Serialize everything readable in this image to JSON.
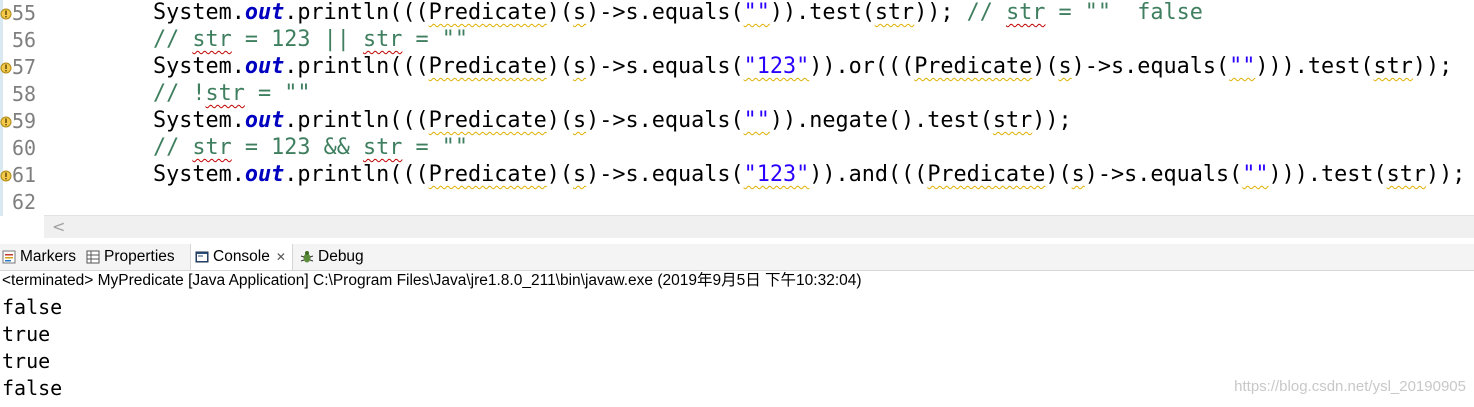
{
  "editor": {
    "lines": [
      {
        "num": "55",
        "warn": true,
        "type": "code"
      },
      {
        "num": "56",
        "warn": false,
        "type": "comment"
      },
      {
        "num": "57",
        "warn": true,
        "type": "code"
      },
      {
        "num": "58",
        "warn": false,
        "type": "comment"
      },
      {
        "num": "59",
        "warn": true,
        "type": "code"
      },
      {
        "num": "60",
        "warn": false,
        "type": "comment"
      },
      {
        "num": "61",
        "warn": true,
        "type": "code"
      },
      {
        "num": "62",
        "warn": false,
        "type": "empty"
      }
    ],
    "code": {
      "l55": {
        "a": "System.",
        "out": "out",
        "b": ".println(((",
        "pred": "Predicate",
        "c": ")(",
        "s1": "s",
        "d": ")->s.equals(",
        "str1": "\"\"",
        "e": ")).test(",
        "arg": "str",
        "f": "));",
        "cm1": " // ",
        "cmstr": "str",
        "cm2": " = \"\"  false"
      },
      "l56": {
        "cm1": "// ",
        "cmstr1": "str",
        "cm2": " = 123 || ",
        "cmstr2": "str",
        "cm3": " = \"\""
      },
      "l57": {
        "a": "System.",
        "out": "out",
        "b": ".println(((",
        "pred1": "Predicate",
        "c": ")(",
        "s1": "s",
        "d": ")->s.equals(",
        "str1": "\"123\"",
        "e": ")).or(((",
        "pred2": "Predicate",
        "f": ")(",
        "s2": "s",
        "g": ")->s.equals(",
        "str2": "\"\"",
        "h": "))).test(",
        "arg": "str",
        "i": "));"
      },
      "l58": {
        "cm1": "// !",
        "cmstr1": "str",
        "cm2": " = \"\""
      },
      "l59": {
        "a": "System.",
        "out": "out",
        "b": ".println(((",
        "pred": "Predicate",
        "c": ")(",
        "s1": "s",
        "d": ")->s.equals(",
        "str1": "\"\"",
        "e": ")).negate().test(",
        "arg": "str",
        "f": "));"
      },
      "l60": {
        "cm1": "// ",
        "cmstr1": "str",
        "cm2": " = 123 && ",
        "cmstr2": "str",
        "cm3": " = \"\""
      },
      "l61": {
        "a": "System.",
        "out": "out",
        "b": ".println(((",
        "pred1": "Predicate",
        "c": ")(",
        "s1": "s",
        "d": ")->s.equals(",
        "str1": "\"123\"",
        "e": ")).and(((",
        "pred2": "Predicate",
        "f": ")(",
        "s2": "s",
        "g": ")->s.equals(",
        "str2": "\"\"",
        "h": "))).test(",
        "arg": "str",
        "i": "));"
      }
    },
    "scroll_left_glyph": "<"
  },
  "views": {
    "tabs": [
      {
        "label": "Markers",
        "icon": "markers-icon"
      },
      {
        "label": "Properties",
        "icon": "properties-icon"
      },
      {
        "label": "Console",
        "icon": "console-icon",
        "active": true,
        "close": "✕"
      },
      {
        "label": "Debug",
        "icon": "debug-icon"
      }
    ],
    "status": "<terminated> MyPredicate [Java Application] C:\\Program Files\\Java\\jre1.8.0_211\\bin\\javaw.exe (2019年9月5日 下午10:32:04)",
    "output": [
      "false",
      "true",
      "true",
      "false"
    ]
  },
  "watermark": "https://blog.csdn.net/ysl_20190905",
  "colors": {
    "keyword_field": "#0000c0",
    "string": "#2a00ff",
    "comment": "#3f7f5f",
    "warning_squiggle": "#e0b000"
  }
}
